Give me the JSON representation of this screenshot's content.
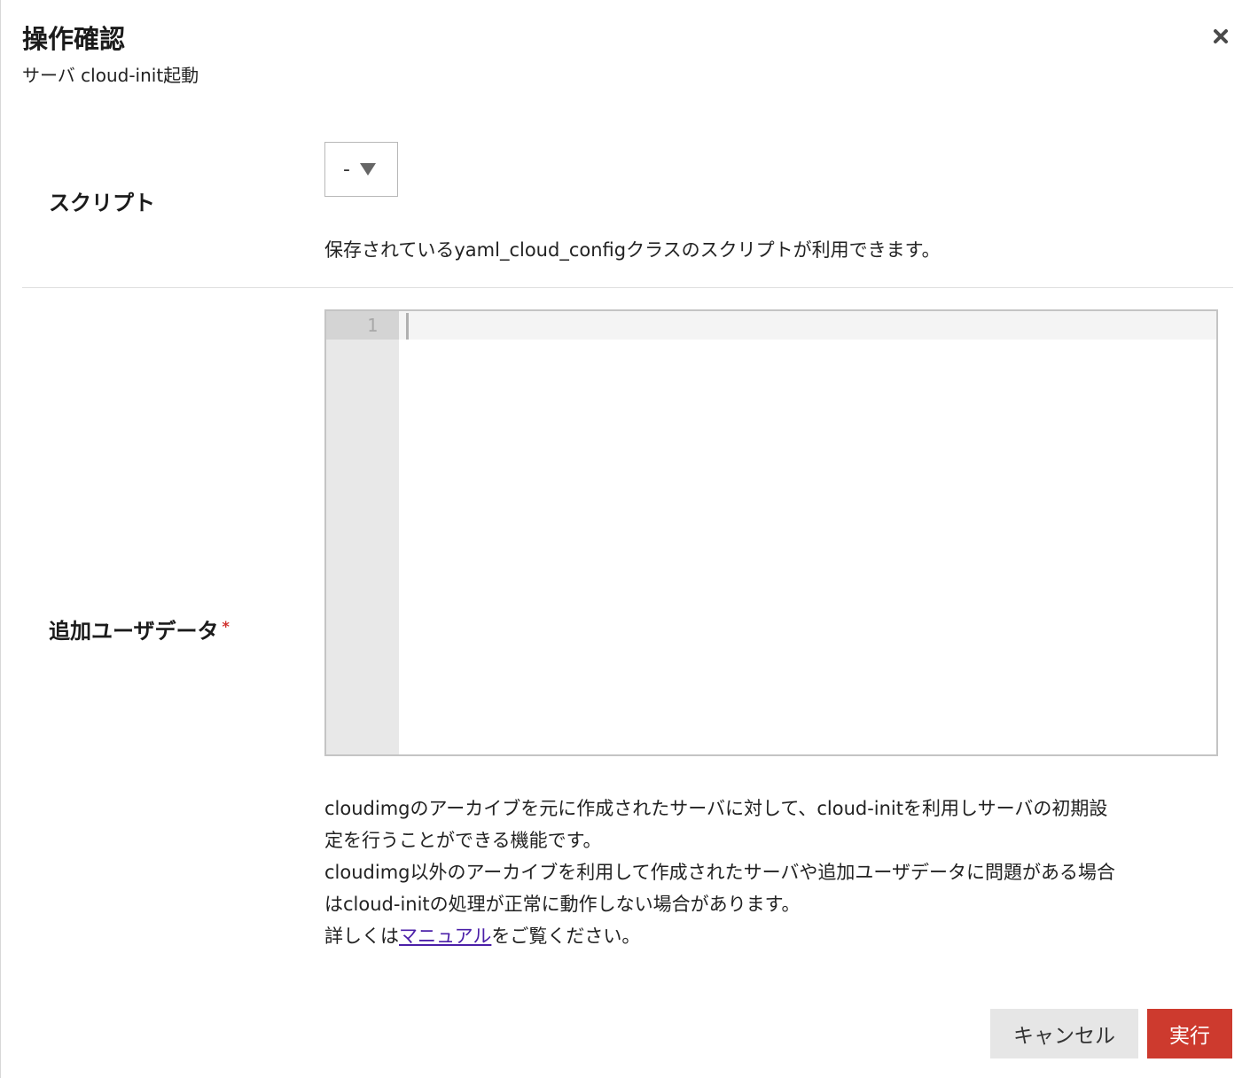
{
  "dialog": {
    "title": "操作確認",
    "subtitle": "サーバ cloud-init起動",
    "close_icon": "close-icon"
  },
  "script_field": {
    "label": "スクリプト",
    "selected_value": "-",
    "help": "保存されているyaml_cloud_configクラスのスクリプトが利用できます。"
  },
  "userdata_field": {
    "label": "追加ユーザデータ",
    "required_mark": "*",
    "editor": {
      "line_numbers": [
        "1"
      ],
      "content": ""
    }
  },
  "description": {
    "line1": "cloudimgのアーカイブを元に作成されたサーバに対して、cloud-initを利用しサーバの初期設",
    "line2": "定を行うことができる機能です。",
    "line3": "cloudimg以外のアーカイブを利用して作成されたサーバや追加ユーザデータに問題がある場合",
    "line4": "はcloud-initの処理が正常に動作しない場合があります。",
    "line5_prefix": "詳しくは",
    "line5_link": "マニュアル",
    "line5_suffix": "をご覧ください。"
  },
  "buttons": {
    "cancel": "キャンセル",
    "run": "実行"
  },
  "colors": {
    "primary": "#cd3a2e",
    "link": "#4b1fa8",
    "required": "#d0312d"
  }
}
